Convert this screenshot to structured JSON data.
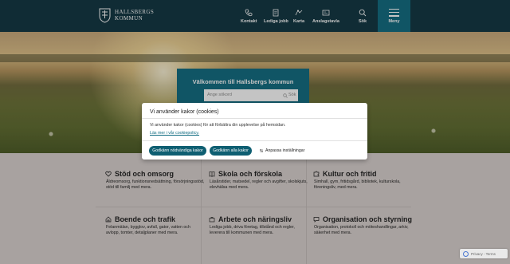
{
  "header": {
    "logo_line1": "HALLSBERGS",
    "logo_line2": "KOMMUN",
    "nav": [
      {
        "label": "Kontakt",
        "icon": "phone-icon"
      },
      {
        "label": "Lediga jobb",
        "icon": "document-icon"
      },
      {
        "label": "Karta",
        "icon": "map-icon"
      },
      {
        "label": "Anslagstavla",
        "icon": "bulletin-board-icon"
      },
      {
        "label": "Sök",
        "icon": "search-icon"
      }
    ],
    "menu_label": "Meny"
  },
  "hero": {
    "welcome_title": "Välkommen till Hallsbergs kommun",
    "search_placeholder": "Ange sökord",
    "search_button": "Sök"
  },
  "cookie_dialog": {
    "title": "Vi använder kakor (cookies)",
    "text": "Vi använder kakor (cookies) för att förbättra din upplevelse på hemsidan.",
    "link": "Läs mer i vår cookiepolicy.",
    "accept_necessary": "Godkänn nödvändiga kakor",
    "accept_all": "Godkänn alla kakor",
    "settings": "Anpassa inställningar"
  },
  "categories": [
    {
      "title": "Stöd och omsorg",
      "icon": "heart-icon",
      "text": "Äldreomsorg, funktionsnedsättning, försörjningsstöd, stöd till familj med mera."
    },
    {
      "title": "Skola och förskola",
      "icon": "book-icon",
      "text": "Läsårstider, matsedel, regler och avgifter, skolskjuts, elevhälsa med mera."
    },
    {
      "title": "Kultur och fritid",
      "icon": "puzzle-icon",
      "text": "Simhall, gym, fritidsgård, bibliotek, kulturskola, föreningsliv, med mera."
    },
    {
      "title": "Boende och trafik",
      "icon": "house-icon",
      "text": "Felanmälan, bygglov, avfall, gator, vatten och avlopp, tomter, detaljplaner med mera."
    },
    {
      "title": "Arbete och näringsliv",
      "icon": "briefcase-icon",
      "text": "Lediga jobb, driva företag, tillstånd och regler, leverera till kommunen med mera."
    },
    {
      "title": "Organisation och styrning",
      "icon": "chat-icon",
      "text": "Organisation, protokoll och möteshandlingar, arkiv, säkerhet med mera."
    }
  ],
  "recaptcha_text": "Privacy - Terms"
}
